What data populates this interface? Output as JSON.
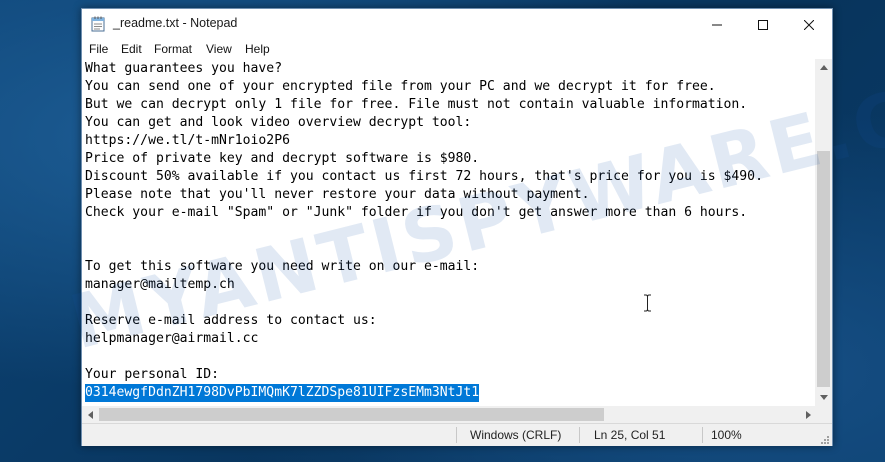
{
  "window": {
    "title": "_readme.txt - Notepad",
    "app_icon": "notepad-icon",
    "controls": {
      "minimize_icon": "minimize-icon",
      "maximize_icon": "maximize-icon",
      "close_icon": "close-icon"
    }
  },
  "menu": {
    "items": [
      {
        "label": "File"
      },
      {
        "label": "Edit"
      },
      {
        "label": "Format"
      },
      {
        "label": "View"
      },
      {
        "label": "Help"
      }
    ]
  },
  "document": {
    "lines": [
      "What guarantees you have?",
      "You can send one of your encrypted file from your PC and we decrypt it for free.",
      "But we can decrypt only 1 file for free. File must not contain valuable information.",
      "You can get and look video overview decrypt tool:",
      "https://we.tl/t-mNr1oio2P6",
      "Price of private key and decrypt software is $980.",
      "Discount 50% available if you contact us first 72 hours, that's price for you is $490.",
      "Please note that you'll never restore your data without payment.",
      "Check your e-mail \"Spam\" or \"Junk\" folder if you don't get answer more than 6 hours.",
      "",
      "",
      "To get this software you need write on our e-mail:",
      "manager@mailtemp.ch",
      "",
      "Reserve e-mail address to contact us:",
      "helpmanager@airmail.cc",
      "",
      "Your personal ID:",
      "0314ewgfDdnZH1798DvPbIMQmK7lZZDSpe81UIFzsEMm3NtJt1"
    ],
    "selected_line_index": 18
  },
  "status": {
    "encoding": "Windows (CRLF)",
    "position": "Ln 25, Col 51",
    "zoom": "100%"
  },
  "watermark": "MYANTISPYWARE.COM",
  "colors": {
    "selection": "#0078d7",
    "desktop": "#0b3a66"
  }
}
